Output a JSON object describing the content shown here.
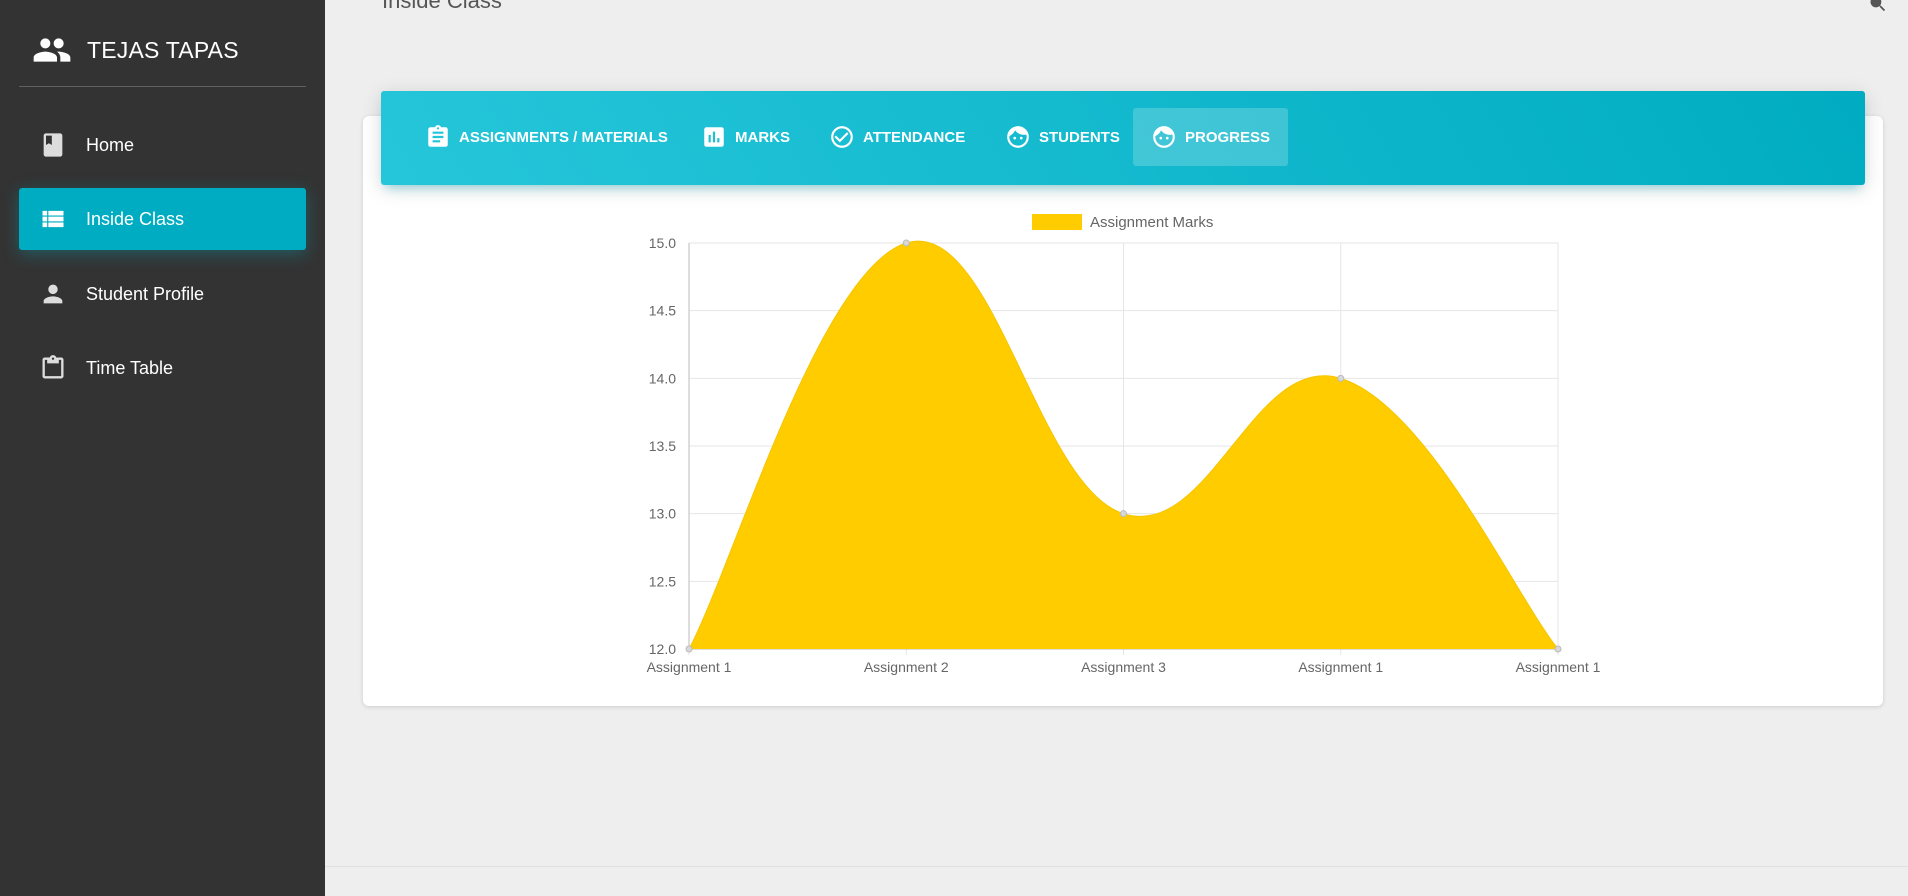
{
  "page": {
    "heading": "Inside Class"
  },
  "sidebar": {
    "brand": "TEJAS TAPAS",
    "items": [
      {
        "label": "Home",
        "icon": "book-icon",
        "active": false
      },
      {
        "label": "Inside Class",
        "icon": "list-icon",
        "active": true
      },
      {
        "label": "Student Profile",
        "icon": "person-icon",
        "active": false
      },
      {
        "label": "Time Table",
        "icon": "clipboard-icon",
        "active": false
      }
    ]
  },
  "tabs": [
    {
      "label": "ASSIGNMENTS / MATERIALS",
      "icon": "assignment-icon",
      "active": false
    },
    {
      "label": "MARKS",
      "icon": "bar-chart-icon",
      "active": false
    },
    {
      "label": "ATTENDANCE",
      "icon": "check-circle-icon",
      "active": false
    },
    {
      "label": "STUDENTS",
      "icon": "face-icon",
      "active": false
    },
    {
      "label": "PROGRESS",
      "icon": "face-icon",
      "active": true
    }
  ],
  "colors": {
    "accent": "#00acc1",
    "sidebar": "#333333",
    "series": "#ffcc00"
  },
  "chart_data": {
    "type": "area",
    "categories": [
      "Assignment 1",
      "Assignment 2",
      "Assignment 3",
      "Assignment 1",
      "Assignment 1"
    ],
    "series": [
      {
        "name": "Assignment Marks",
        "values": [
          12,
          15,
          13,
          14,
          12
        ]
      }
    ],
    "ylim": [
      12,
      15
    ],
    "yticks": [
      "15.0",
      "14.5",
      "14.0",
      "13.5",
      "13.0",
      "12.5",
      "12.0"
    ],
    "grid": true,
    "legend": "top",
    "smooth": true
  }
}
